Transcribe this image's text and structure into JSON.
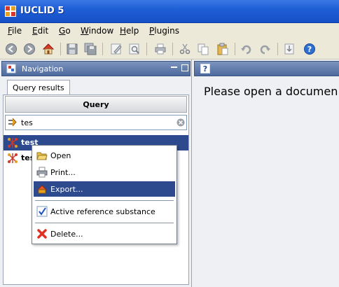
{
  "window": {
    "title": "IUCLID 5"
  },
  "menubar": {
    "items": [
      {
        "label": "File",
        "mnemonic": "F",
        "rest": "ile"
      },
      {
        "label": "Edit",
        "mnemonic": "E",
        "rest": "dit"
      },
      {
        "label": "Go",
        "mnemonic": "G",
        "rest": "o"
      },
      {
        "label": "Window",
        "mnemonic": "W",
        "rest": "indow"
      },
      {
        "label": "Help",
        "mnemonic": "H",
        "rest": "elp"
      },
      {
        "label": "Plugins",
        "mnemonic": "P",
        "rest": "lugins"
      }
    ]
  },
  "toolbar": {
    "icons": [
      "back-icon",
      "forward-icon",
      "home-icon",
      "save-icon",
      "save-all-icon",
      "edit-icon",
      "preview-icon",
      "print-icon",
      "cut-icon",
      "copy-icon",
      "paste-icon",
      "undo-icon",
      "redo-icon",
      "import-icon",
      "help-icon"
    ]
  },
  "navigation": {
    "title": "Navigation",
    "tab_label": "Query results",
    "query_header": "Query",
    "search_value": "tes",
    "results": [
      {
        "label": "test",
        "icon": "substance-icon",
        "selected": true
      },
      {
        "label": "tes",
        "icon": "substance-icon",
        "selected": false
      }
    ]
  },
  "main": {
    "message": "Please open a documen"
  },
  "context_menu": {
    "items": [
      {
        "label": "Open",
        "icon": "folder-open-icon"
      },
      {
        "label": "Print...",
        "icon": "printer-icon"
      },
      {
        "label": "Export...",
        "icon": "export-icon",
        "highlighted": true
      },
      {
        "label": "Active reference substance",
        "icon": "checkmark-icon"
      },
      {
        "label": "Delete...",
        "icon": "delete-icon"
      }
    ]
  },
  "colors": {
    "titlebar": "#1f5fd6",
    "selection": "#2e4a8e",
    "panel_header": "#4d6a9d"
  }
}
